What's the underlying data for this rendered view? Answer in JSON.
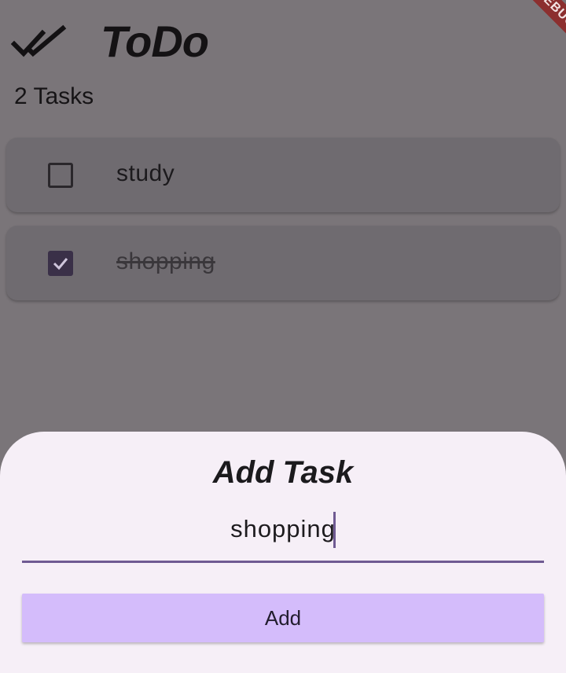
{
  "app": {
    "title": "ToDo",
    "icon": "double-check-icon",
    "task_count_label": "2 Tasks"
  },
  "tasks": [
    {
      "label": "study",
      "completed": false
    },
    {
      "label": "shopping",
      "completed": true
    }
  ],
  "sheet": {
    "title": "Add Task",
    "input_value": "shopping",
    "button_label": "Add"
  },
  "debug_banner": {
    "label": "DEBUG"
  },
  "colors": {
    "scrim_background": "#7a7579",
    "card_background": "#6f6b70",
    "sheet_background": "#f6eff7",
    "accent": "#6f5a92",
    "button_background": "#d4bcfb",
    "checkbox_checked": "#3a3048",
    "debug_banner": "#8c2f2f"
  }
}
